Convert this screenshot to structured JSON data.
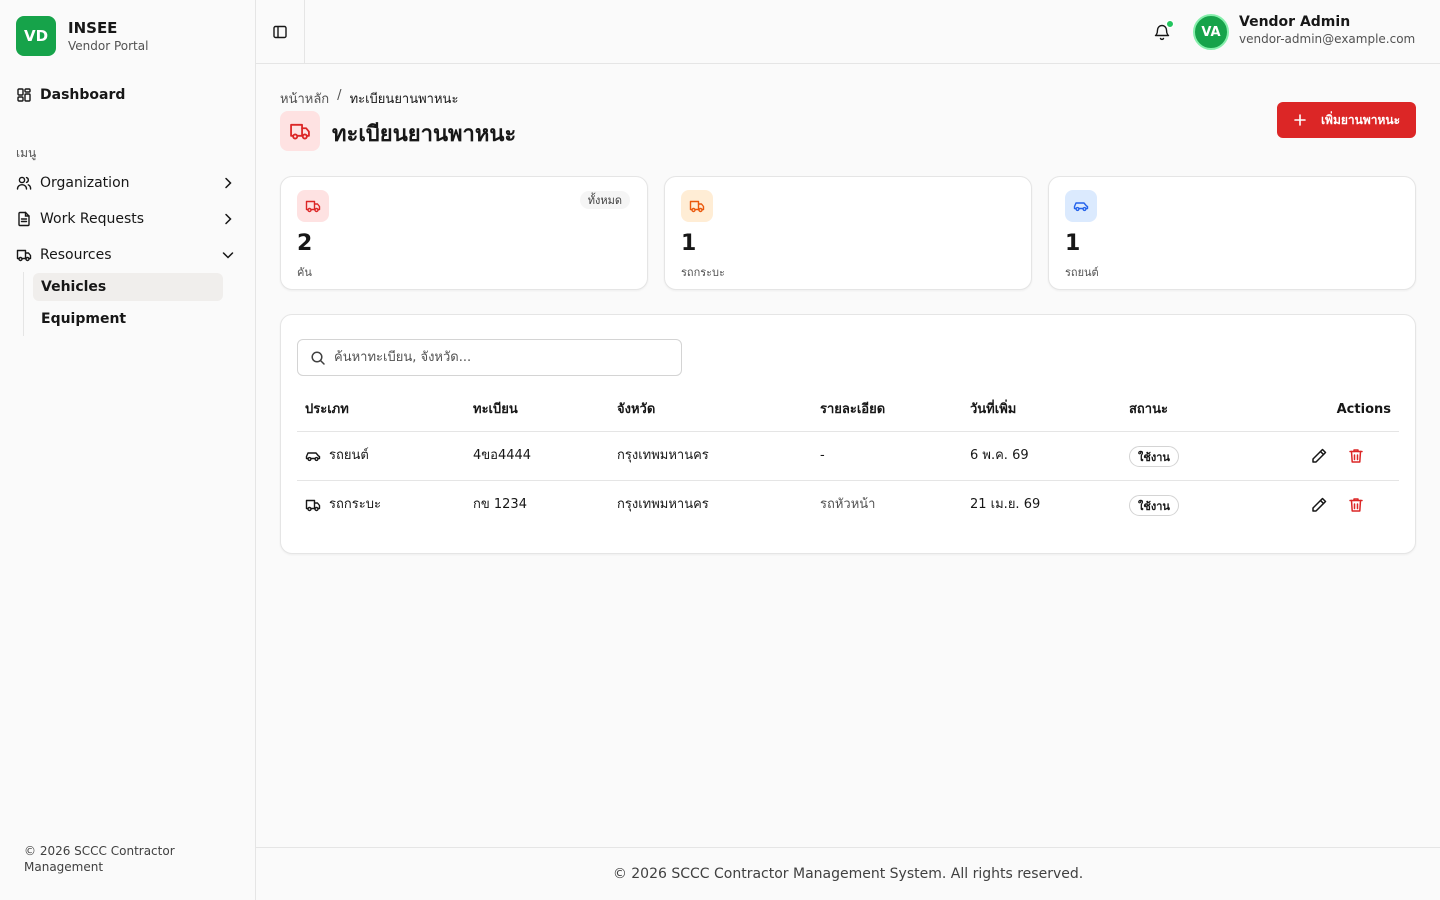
{
  "brand": {
    "logo": "VD",
    "name": "INSEE",
    "subtitle": "Vendor Portal"
  },
  "sidebar": {
    "dashboard": "Dashboard",
    "menu_label": "เมนู",
    "items": [
      {
        "label": "Organization",
        "icon": "users-icon"
      },
      {
        "label": "Work Requests",
        "icon": "file-text-icon"
      },
      {
        "label": "Resources",
        "icon": "truck-icon"
      }
    ],
    "sub_items": [
      {
        "label": "Vehicles",
        "active": true
      },
      {
        "label": "Equipment",
        "active": false
      }
    ],
    "footer": "© 2026 SCCC Contractor Management"
  },
  "header": {
    "user": {
      "initials": "VA",
      "name": "Vendor Admin",
      "email": "vendor-admin@example.com"
    }
  },
  "breadcrumb": {
    "home": "หน้าหลัก",
    "separator": "/",
    "current": "ทะเบียนยานพาหนะ"
  },
  "page": {
    "title": "ทะเบียนยานพาหนะ",
    "add_button": "เพิ่มยานพาหนะ"
  },
  "stats": [
    {
      "value": "2",
      "label": "คัน",
      "badge": "ทั้งหมด",
      "color": "#dc2626",
      "bg": "#fee2e2"
    },
    {
      "value": "1",
      "label": "รถกระบะ",
      "color": "#ea580c",
      "bg": "#ffedd5"
    },
    {
      "value": "1",
      "label": "รถยนต์",
      "color": "#2563eb",
      "bg": "#dbeafe"
    }
  ],
  "search": {
    "placeholder": "ค้นหาทะเบียน, จังหวัด..."
  },
  "table": {
    "headers": {
      "type": "ประเภท",
      "plate": "ทะเบียน",
      "province": "จังหวัด",
      "detail": "รายละเอียด",
      "date": "วันที่เพิ่ม",
      "status": "สถานะ",
      "actions": "Actions"
    },
    "rows": [
      {
        "type": "รถยนต์",
        "plate": "4ขอ4444",
        "province": "กรุงเทพมหานคร",
        "detail": "-",
        "date": "6 พ.ค. 69",
        "status": "ใช้งาน"
      },
      {
        "type": "รถกระบะ",
        "plate": "กข 1234",
        "province": "กรุงเทพมหานคร",
        "detail": "รถหัวหน้า",
        "date": "21 เม.ย. 69",
        "status": "ใช้งาน"
      }
    ]
  },
  "footer": "© 2026 SCCC Contractor Management System. All rights reserved.",
  "colors": {
    "brand_green": "#16a34a",
    "accent_red": "#dc2626"
  }
}
